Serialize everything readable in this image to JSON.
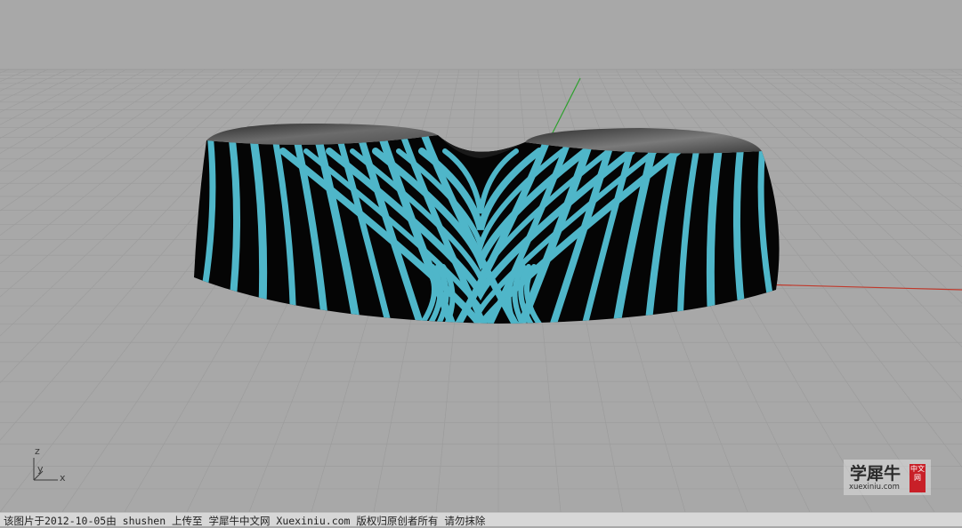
{
  "viewport": {
    "background": "#a8a8a8",
    "grid_color": "#9c9c9c",
    "x_axis_color": "#c0392b",
    "y_axis_color": "#2ea02e",
    "stripe_light": "#4fb6c9",
    "stripe_dark": "#050505",
    "axis_icon_labels": {
      "z": "z",
      "y": "y",
      "x": "x"
    }
  },
  "watermark": {
    "main_text": "学犀牛",
    "url_text": "xuexiniu.com",
    "seal_text": "中文网"
  },
  "footer": {
    "text": "该图片于2012-10-05由 shushen 上传至 学犀牛中文网 Xuexiniu.com 版权归原创者所有 请勿抹除"
  }
}
